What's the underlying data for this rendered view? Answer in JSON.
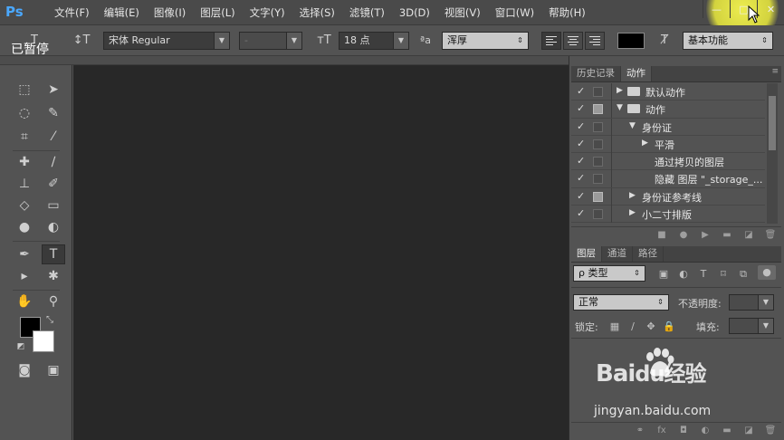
{
  "app": {
    "logo": "Ps",
    "paused_label": "已暂停"
  },
  "menu": {
    "items": [
      "文件(F)",
      "编辑(E)",
      "图像(I)",
      "图层(L)",
      "文字(Y)",
      "选择(S)",
      "滤镜(T)",
      "3D(D)",
      "视图(V)",
      "窗口(W)",
      "帮助(H)"
    ]
  },
  "window_controls": {
    "minimize": "—",
    "maximize": "□",
    "close": "✕"
  },
  "options": {
    "font_family": "宋体 Regular",
    "font_style": "-",
    "font_size": "18 点",
    "aa_label": "ªa",
    "antialias": "浑厚",
    "workspace": "基本功能",
    "text_color": "#000000"
  },
  "actions_panel": {
    "tabs": [
      "历史记录",
      "动作"
    ],
    "active_tab": "动作",
    "rows": [
      {
        "check": "✓",
        "box": "empty",
        "indent": 0,
        "tri": "▶",
        "folder": true,
        "label": "默认动作"
      },
      {
        "check": "✓",
        "box": "filled",
        "indent": 0,
        "tri": "▼",
        "folder": true,
        "label": "动作"
      },
      {
        "check": "✓",
        "box": "empty",
        "indent": 1,
        "tri": "▼",
        "folder": false,
        "label": "身份证"
      },
      {
        "check": "✓",
        "box": "empty",
        "indent": 2,
        "tri": "▶",
        "folder": false,
        "label": "平滑"
      },
      {
        "check": "✓",
        "box": "empty",
        "indent": 2,
        "tri": "",
        "folder": false,
        "label": "通过拷贝的图层"
      },
      {
        "check": "✓",
        "box": "empty",
        "indent": 2,
        "tri": "",
        "folder": false,
        "label": "隐藏 图层 \"_storage_..."
      },
      {
        "check": "✓",
        "box": "filled",
        "indent": 1,
        "tri": "▶",
        "folder": false,
        "label": "身份证参考线"
      },
      {
        "check": "✓",
        "box": "empty",
        "indent": 1,
        "tri": "▶",
        "folder": false,
        "label": "小二寸排版"
      }
    ]
  },
  "layers_panel": {
    "tabs": [
      "图层",
      "通道",
      "路径"
    ],
    "active_tab": "图层",
    "filter_label": "ρ 类型",
    "blend_mode": "正常",
    "opacity_label": "不透明度:",
    "lock_label": "锁定:",
    "fill_label": "填充:"
  },
  "watermark": {
    "brand": "Bai",
    "brand2": "du",
    "brand_cn": "经验",
    "url": "jingyan.baidu.com"
  },
  "colors": {
    "foreground": "#000000",
    "background": "#ffffff",
    "spotlight": "#f0f050",
    "accent": "#4aa8ff"
  }
}
